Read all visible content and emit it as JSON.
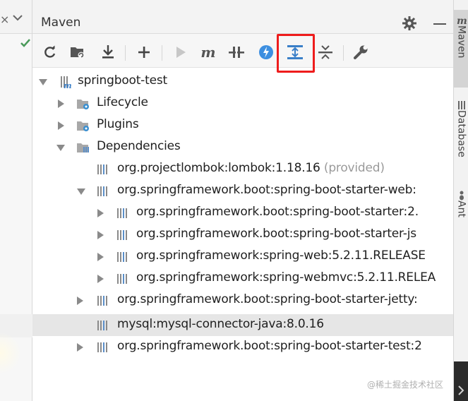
{
  "panel": {
    "title": "Maven"
  },
  "toolbar": {
    "buttons": [
      {
        "name": "reload-all-icon"
      },
      {
        "name": "generate-sources-icon"
      },
      {
        "name": "download-sources-icon"
      },
      {
        "name": "add-project-icon"
      },
      {
        "name": "run-icon"
      },
      {
        "name": "execute-goal-icon",
        "glyph": "m"
      },
      {
        "name": "toggle-offline-icon"
      },
      {
        "name": "skip-tests-icon"
      },
      {
        "name": "show-dependencies-icon"
      },
      {
        "name": "collapse-all-icon"
      },
      {
        "name": "settings-icon"
      }
    ],
    "accent_highlight": "#ee1c1c"
  },
  "tree": {
    "project": "springboot-test",
    "lifecycle": "Lifecycle",
    "plugins": "Plugins",
    "dependencies": "Dependencies",
    "deps": [
      {
        "label": "org.projectlombok:lombok:1.18.16",
        "scope": "(provided)"
      },
      {
        "label": "org.springframework.boot:spring-boot-starter-web:"
      },
      {
        "label": "org.springframework.boot:spring-boot-starter:2."
      },
      {
        "label": "org.springframework.boot:spring-boot-starter-js"
      },
      {
        "label": "org.springframework:spring-web:5.2.11.RELEASE"
      },
      {
        "label": "org.springframework:spring-webmvc:5.2.11.RELEA"
      },
      {
        "label": "org.springframework.boot:spring-boot-starter-jetty:"
      },
      {
        "label": "mysql:mysql-connector-java:8.0.16"
      },
      {
        "label": "org.springframework.boot:spring-boot-starter-test:2"
      }
    ]
  },
  "rightbar": {
    "tabs": [
      "Maven",
      "Database",
      "Ant"
    ]
  },
  "watermark": "@稀土掘金技术社区"
}
